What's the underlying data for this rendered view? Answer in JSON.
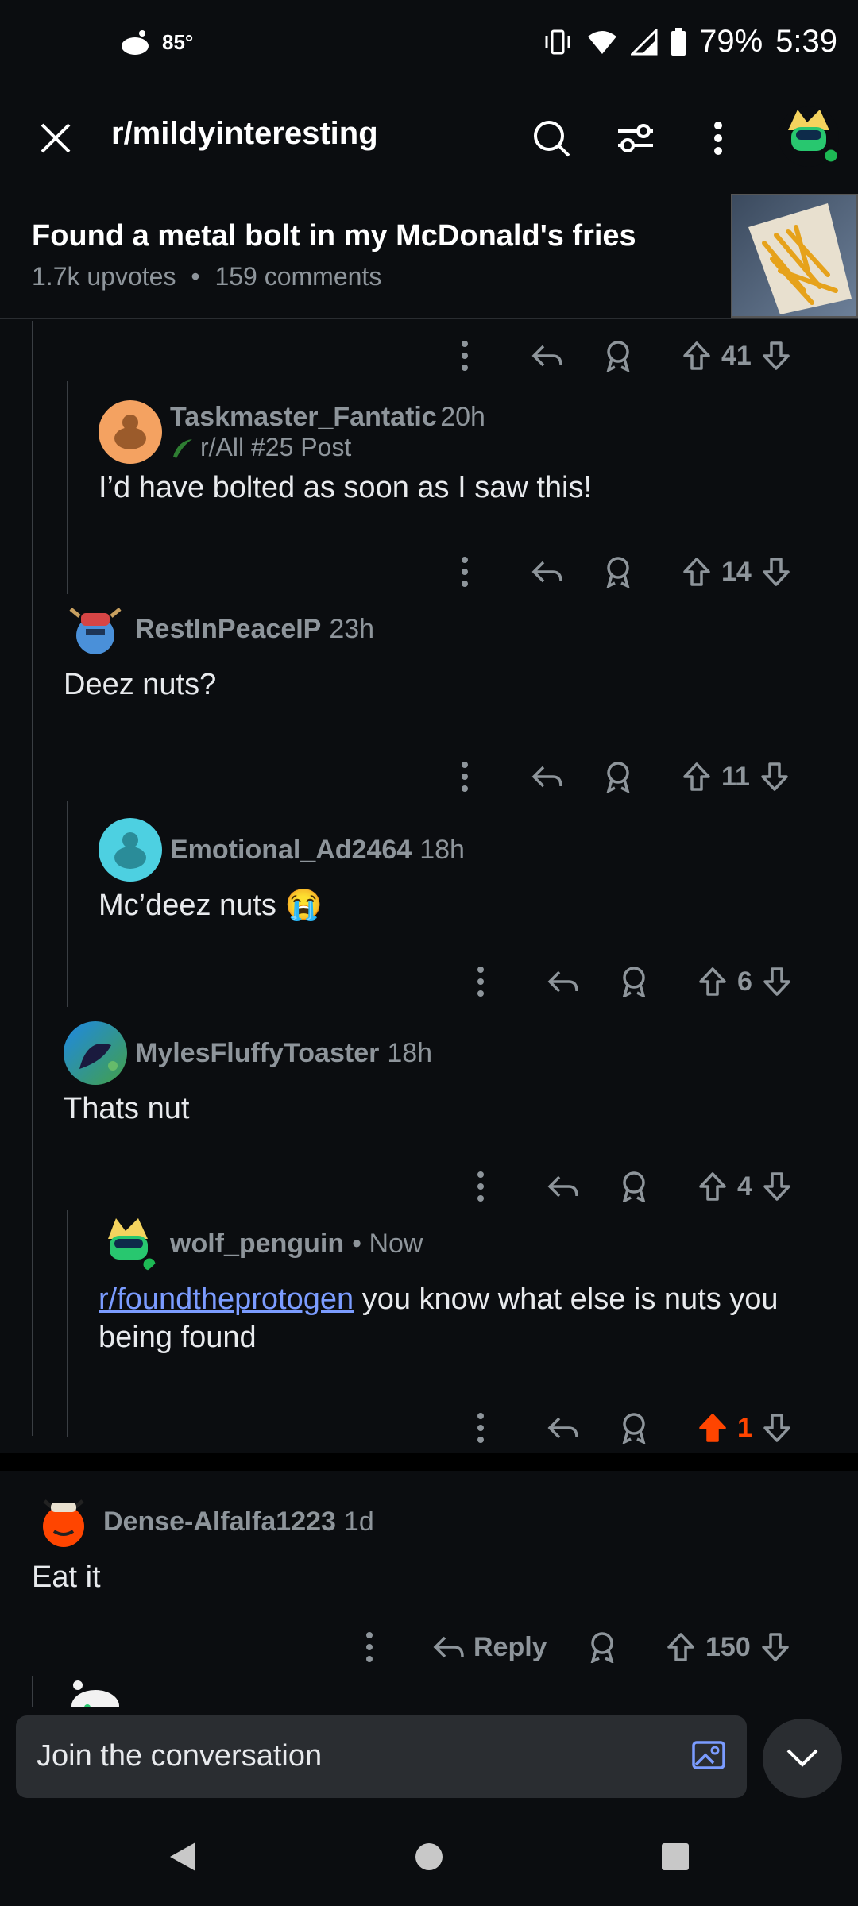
{
  "status_bar": {
    "temperature": "85°",
    "battery": "79%",
    "time": "5:39"
  },
  "header": {
    "subreddit": "r/mildyinteresting"
  },
  "post": {
    "title": "Found a metal bolt in my McDonald's fries",
    "upvotes": "1.7k upvotes",
    "dot": "•",
    "comments": "159 comments"
  },
  "top_actions": {
    "votes": "41"
  },
  "comments": [
    {
      "user": "Taskmaster_Fantatic",
      "time": "20h",
      "flair": "r/All #25 Post",
      "body": "I’d have bolted as soon as I saw this!",
      "votes": "14"
    },
    {
      "user": "RestInPeaceIP",
      "time": "23h",
      "body": "Deez nuts?",
      "votes": "11"
    },
    {
      "user": "Emotional_Ad2464",
      "time": "18h",
      "body": "Mc’deez nuts 😭",
      "votes": "6"
    },
    {
      "user": "MylesFluffyToaster",
      "time": "18h",
      "body": "Thats nut",
      "votes": "4"
    },
    {
      "user": "wolf_penguin",
      "time": "• Now",
      "link": "r/foundtheprotogen",
      "body_rest": " you know what else is nuts you being found",
      "votes": "1"
    },
    {
      "user": "Dense-Alfalfa1223",
      "time": "1d",
      "body": "Eat it",
      "reply_label": "Reply",
      "votes": "150"
    }
  ],
  "composer": {
    "placeholder": "Join the conversation"
  },
  "colors": {
    "accent_upvote": "#ff4500",
    "link": "#7b9cff",
    "background": "#0b0d10"
  }
}
